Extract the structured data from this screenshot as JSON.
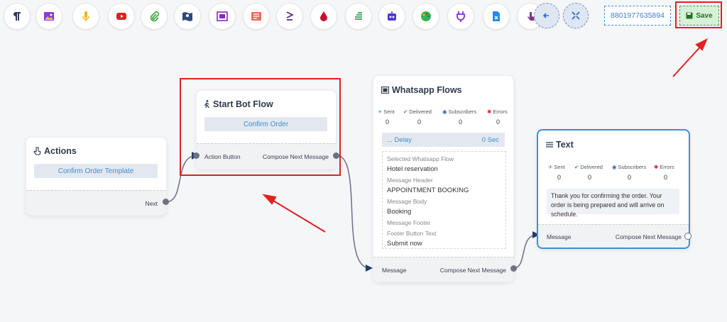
{
  "toolbar": {
    "icons": [
      "paragraph-icon",
      "image-icon",
      "microphone-icon",
      "youtube-icon",
      "attachment-icon",
      "map-icon",
      "carousel-icon",
      "newspaper-icon",
      "condition-icon",
      "drop-icon",
      "stack-icon",
      "robot-icon",
      "palette-icon",
      "plug-icon",
      "excel-icon",
      "hand-pointer-icon"
    ],
    "phone": "8801977635894",
    "save_label": "Save"
  },
  "actions_node": {
    "title": "Actions",
    "button": "Confirm Order Template",
    "output_label": "Next"
  },
  "start_node": {
    "title": "Start Bot Flow",
    "button": "Confirm Order",
    "input_label": "Action Button",
    "output_label": "Compose Next Message"
  },
  "whatsapp_node": {
    "title": "Whatsapp Flows",
    "stats": {
      "sent_label": "Sent",
      "sent": "0",
      "delivered_label": "Delivered",
      "delivered": "0",
      "subscribers_label": "Subscribers",
      "subscribers": "0",
      "errors_label": "Errors",
      "errors": "0"
    },
    "delay_label": "... Delay",
    "delay_value": "0 Sec",
    "fields": [
      {
        "label": "Selected Whatsapp Flow",
        "value": "Hotel reservation"
      },
      {
        "label": "Message Header",
        "value": "APPOINTMENT BOOKING"
      },
      {
        "label": "Message Body",
        "value": "Booking"
      },
      {
        "label": "Message Footer",
        "value": ""
      },
      {
        "label": "Footer Button Text",
        "value": "Submit now"
      }
    ],
    "input_label": "Message",
    "output_label": "Compose Next Message"
  },
  "text_node": {
    "title": "Text",
    "stats": {
      "sent_label": "Sent",
      "sent": "0",
      "delivered_label": "Delivered",
      "delivered": "0",
      "subscribers_label": "Subscribers",
      "subscribers": "0",
      "errors_label": "Errors",
      "errors": "0"
    },
    "message": "Thank you for confirming the order. Your order is being prepared and will arrive on schedule.",
    "input_label": "Message",
    "output_label": "Compose Next Message"
  },
  "colors": {
    "accent": "#3d8fd8",
    "highlight": "#e32020",
    "save_bg": "#d6f2d6"
  }
}
